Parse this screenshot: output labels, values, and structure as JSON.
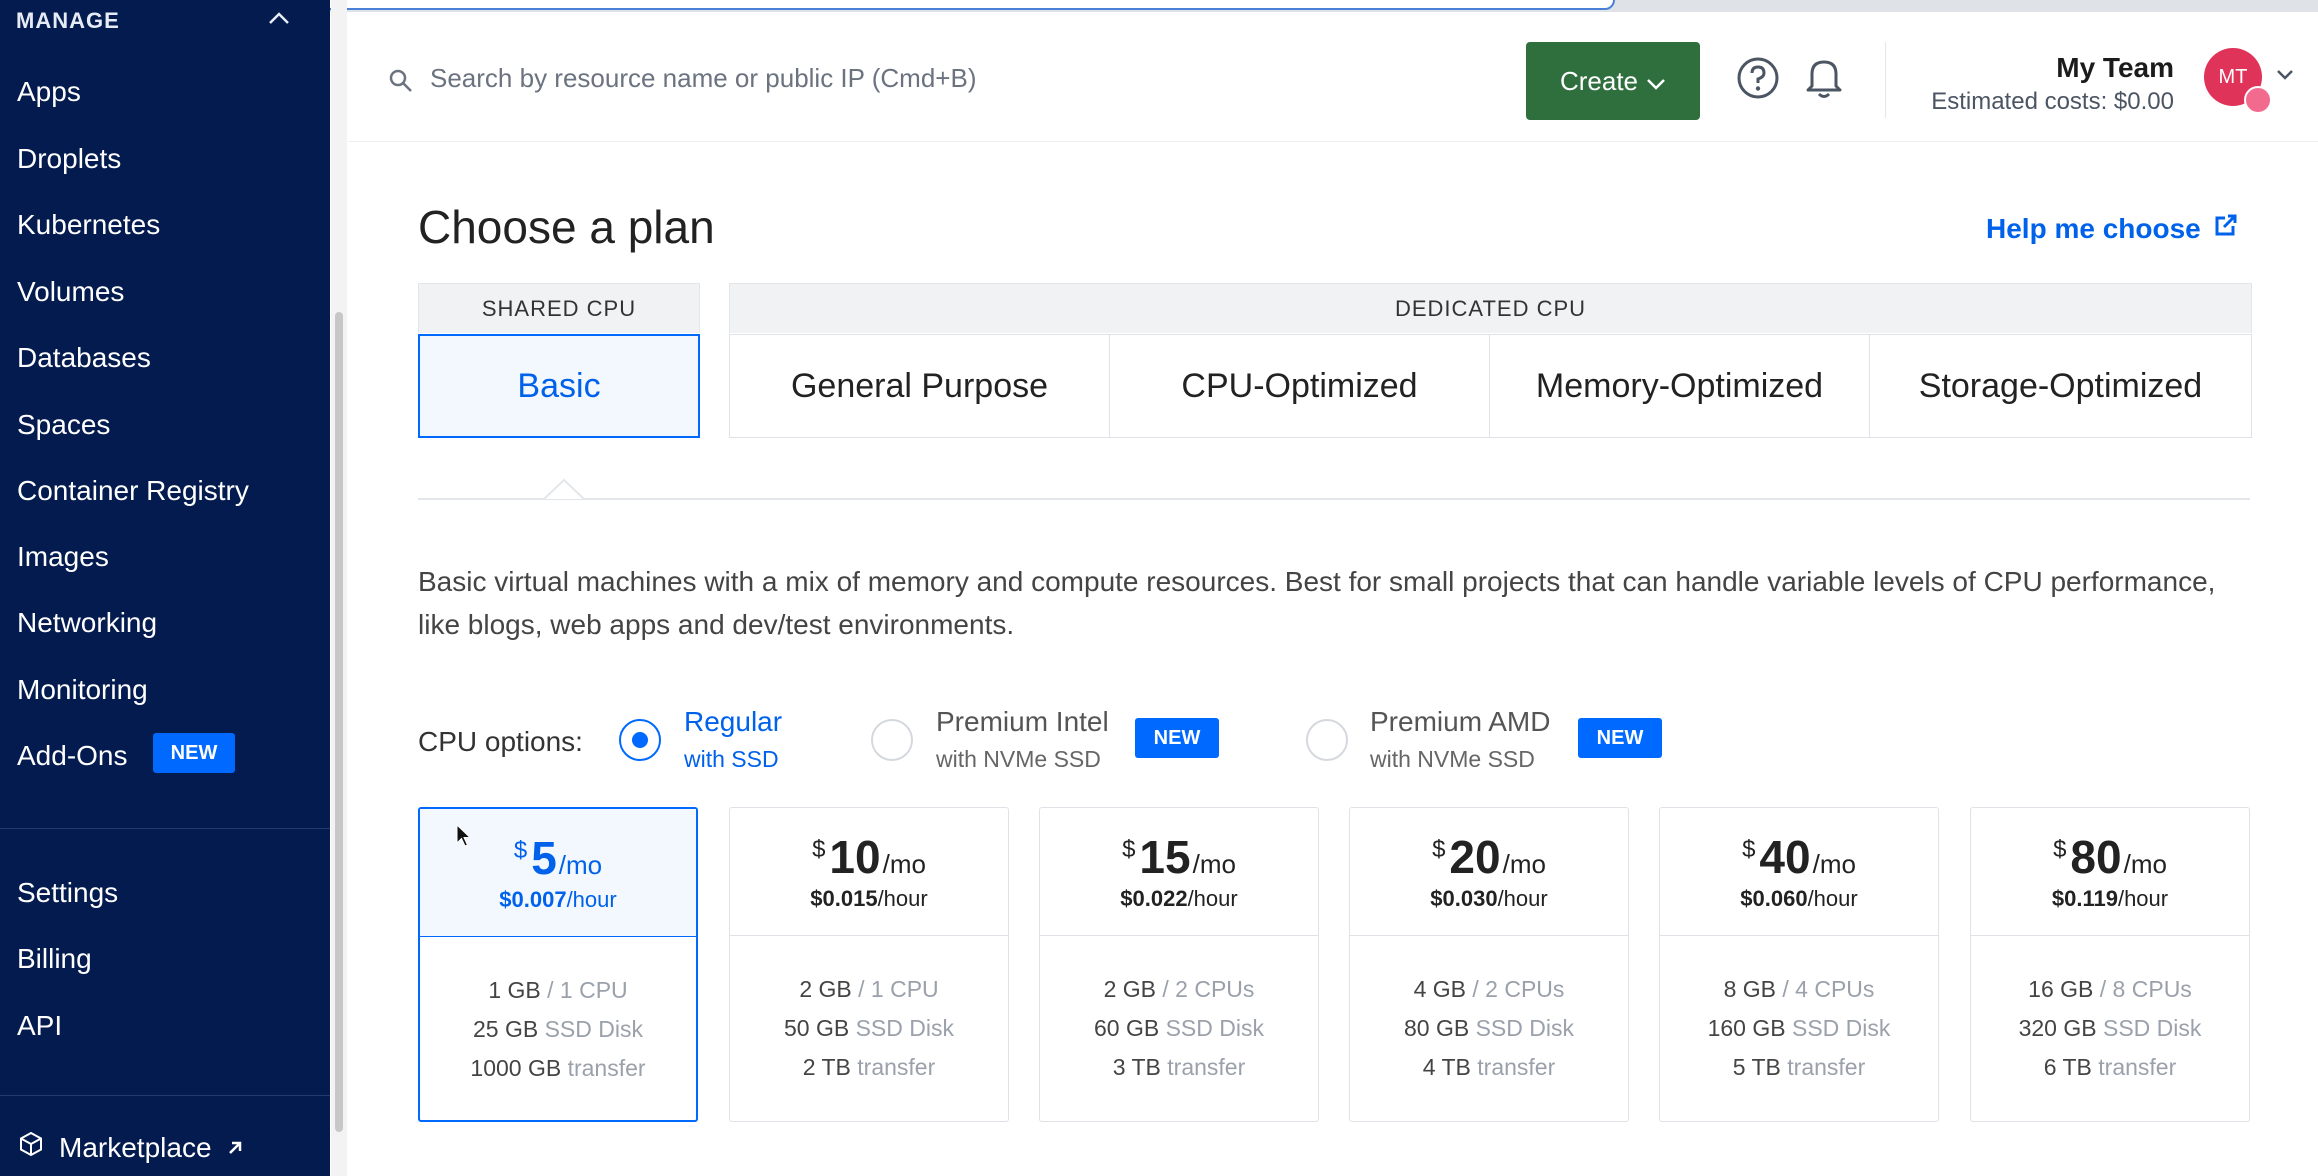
{
  "sidebar": {
    "section_title": "MANAGE",
    "items": [
      {
        "label": "Apps"
      },
      {
        "label": "Droplets"
      },
      {
        "label": "Kubernetes"
      },
      {
        "label": "Volumes"
      },
      {
        "label": "Databases"
      },
      {
        "label": "Spaces"
      },
      {
        "label": "Container Registry"
      },
      {
        "label": "Images"
      },
      {
        "label": "Networking"
      },
      {
        "label": "Monitoring"
      },
      {
        "label": "Add-Ons",
        "badge": "NEW"
      }
    ],
    "account_items": [
      {
        "label": "Settings"
      },
      {
        "label": "Billing"
      },
      {
        "label": "API"
      }
    ],
    "marketplace_label": "Marketplace"
  },
  "header": {
    "search_placeholder": "Search by resource name or public IP (Cmd+B)",
    "create_label": "Create",
    "team_name": "My Team",
    "estimated_costs": "Estimated costs: $0.00",
    "avatar_initials": "MT"
  },
  "main": {
    "title": "Choose a plan",
    "help_link": "Help me choose",
    "categories": {
      "shared": "SHARED CPU",
      "dedicated": "DEDICATED CPU"
    },
    "tabs": [
      {
        "label": "Basic",
        "active": true
      },
      {
        "label": "General Purpose"
      },
      {
        "label": "CPU-Optimized"
      },
      {
        "label": "Memory-Optimized"
      },
      {
        "label": "Storage-Optimized"
      }
    ],
    "description": "Basic virtual machines with a mix of memory and compute resources. Best for small projects that can handle variable levels of CPU performance, like blogs, web apps and dev/test environments.",
    "cpu_options_label": "CPU options:",
    "cpu_options": [
      {
        "title": "Regular",
        "subtitle": "with SSD",
        "selected": true
      },
      {
        "title": "Premium Intel",
        "subtitle": "with NVMe SSD",
        "badge": "NEW"
      },
      {
        "title": "Premium AMD",
        "subtitle": "with NVMe SSD",
        "badge": "NEW"
      }
    ],
    "plans": [
      {
        "currency": "$",
        "price": "5",
        "per_month": "/mo",
        "hourly": "$0.007",
        "per_hour": "/hour",
        "memory": "1 GB",
        "cpu": "/ 1 CPU",
        "disk": "25 GB",
        "disk_label": "SSD Disk",
        "transfer": "1000 GB",
        "transfer_label": "transfer",
        "selected": true
      },
      {
        "currency": "$",
        "price": "10",
        "per_month": "/mo",
        "hourly": "$0.015",
        "per_hour": "/hour",
        "memory": "2 GB",
        "cpu": "/ 1 CPU",
        "disk": "50 GB",
        "disk_label": "SSD Disk",
        "transfer": "2 TB",
        "transfer_label": "transfer"
      },
      {
        "currency": "$",
        "price": "15",
        "per_month": "/mo",
        "hourly": "$0.022",
        "per_hour": "/hour",
        "memory": "2 GB",
        "cpu": "/ 2 CPUs",
        "disk": "60 GB",
        "disk_label": "SSD Disk",
        "transfer": "3 TB",
        "transfer_label": "transfer"
      },
      {
        "currency": "$",
        "price": "20",
        "per_month": "/mo",
        "hourly": "$0.030",
        "per_hour": "/hour",
        "memory": "4 GB",
        "cpu": "/ 2 CPUs",
        "disk": "80 GB",
        "disk_label": "SSD Disk",
        "transfer": "4 TB",
        "transfer_label": "transfer"
      },
      {
        "currency": "$",
        "price": "40",
        "per_month": "/mo",
        "hourly": "$0.060",
        "per_hour": "/hour",
        "memory": "8 GB",
        "cpu": "/ 4 CPUs",
        "disk": "160 GB",
        "disk_label": "SSD Disk",
        "transfer": "5 TB",
        "transfer_label": "transfer"
      },
      {
        "currency": "$",
        "price": "80",
        "per_month": "/mo",
        "hourly": "$0.119",
        "per_hour": "/hour",
        "memory": "16 GB",
        "cpu": "/ 8 CPUs",
        "disk": "320 GB",
        "disk_label": "SSD Disk",
        "transfer": "6 TB",
        "transfer_label": "transfer"
      }
    ]
  },
  "colors": {
    "sidebar_bg": "#031b4e",
    "accent": "#0069ff",
    "create_button": "#2f6f3e",
    "avatar": "#e0335a"
  },
  "icons": {
    "search": "search-icon",
    "help": "help-icon",
    "notifications": "bell-icon",
    "external": "external-link-icon",
    "marketplace": "cube-icon"
  }
}
